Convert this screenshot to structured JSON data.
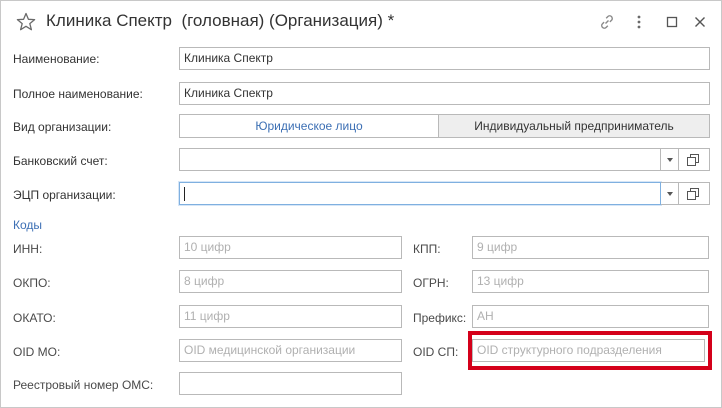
{
  "window": {
    "title": "Клиника Спектр  (головная) (Организация) *",
    "icons": [
      "star-icon",
      "link-icon",
      "more-icon",
      "maximize-icon",
      "close-icon"
    ]
  },
  "form": {
    "name_label": "Наименование:",
    "name_value": "Клиника Спектр",
    "fullname_label": "Полное наименование:",
    "fullname_value": "Клиника Спектр",
    "orgtype_label": "Вид организации:",
    "orgtype_options": [
      "Юридическое лицо",
      "Индивидуальный предприниматель"
    ],
    "orgtype_selected": "Юридическое лицо",
    "bank_label": "Банковский счет:",
    "bank_value": "",
    "eds_label": "ЭЦП организации:",
    "eds_value": ""
  },
  "codes": {
    "section_title": "Коды",
    "inn_label": "ИНН:",
    "inn_placeholder": "10 цифр",
    "kpp_label": "КПП:",
    "kpp_placeholder": "9 цифр",
    "okpo_label": "ОКПО:",
    "okpo_placeholder": "8 цифр",
    "ogrn_label": "ОГРН:",
    "ogrn_placeholder": "13 цифр",
    "okato_label": "ОКАТО:",
    "okato_placeholder": "11 цифр",
    "prefix_label": "Префикс:",
    "prefix_placeholder": "АН",
    "oidmo_label": "OID МО:",
    "oidmo_placeholder": "OID медицинской организации",
    "oidsp_label": "OID СП:",
    "oidsp_placeholder": "OID структурного подразделения",
    "oms_label": "Реестровый номер ОМС:",
    "oms_value": ""
  },
  "colors": {
    "accent": "#3c6fb4",
    "highlight": "#d4001a",
    "border": "#b9b9b9",
    "placeholder": "#b0b0b0"
  }
}
